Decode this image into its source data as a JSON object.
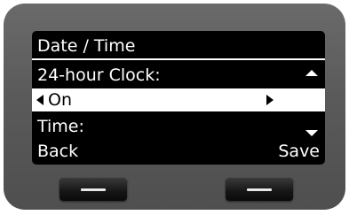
{
  "screen": {
    "title": "Date / Time",
    "setting_label": "24-hour Clock:",
    "setting_value": "On",
    "next_label": "Time:"
  },
  "softkeys": {
    "left_label": "Back",
    "right_label": "Save"
  },
  "icons": {
    "scroll_up": "triangle-up-icon",
    "scroll_down": "triangle-down-icon",
    "option_prev": "triangle-left-icon",
    "option_next": "triangle-right-icon",
    "hardware_key": "dash-icon"
  },
  "colors": {
    "screen_background": "#000000",
    "screen_text": "#ffffff",
    "highlight_background": "#ffffff",
    "highlight_text": "#000000",
    "device_body": "#5a5a5a",
    "hardware_key": "#151515"
  }
}
